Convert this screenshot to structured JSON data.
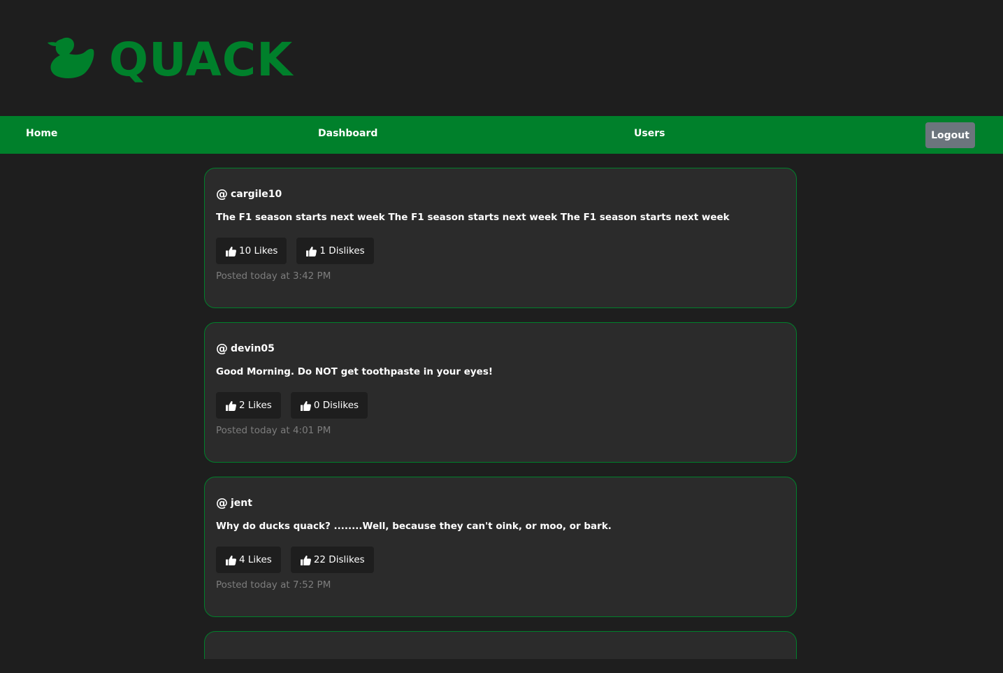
{
  "header": {
    "brand": "QUACK",
    "logo_icon": "duck-icon",
    "brand_color": "#00802b"
  },
  "nav": {
    "home": "Home",
    "dashboard": "Dashboard",
    "users": "Users",
    "logout": "Logout"
  },
  "posts": [
    {
      "user": "cargile10",
      "text": "The F1 season starts next week The F1 season starts next week The F1 season starts next week",
      "likes": "10 Likes",
      "dislikes": "1 Dislikes",
      "time": "Posted today at 3:42 PM"
    },
    {
      "user": "devin05",
      "text": "Good Morning. Do NOT get toothpaste in your eyes!",
      "likes": "2 Likes",
      "dislikes": "0 Dislikes",
      "time": "Posted today at 4:01 PM"
    },
    {
      "user": "jent",
      "text": "Why do ducks quack? ........Well, because they can't oink, or moo, or bark.",
      "likes": "4 Likes",
      "dislikes": "22 Dislikes",
      "time": "Posted today at 7:52 PM"
    }
  ],
  "ui": {
    "at_symbol": "@",
    "vote_icon": "thumbs-up-icon",
    "nav_color": "#00802b",
    "logout_color": "#6c757d",
    "card_border": "#00802b"
  }
}
